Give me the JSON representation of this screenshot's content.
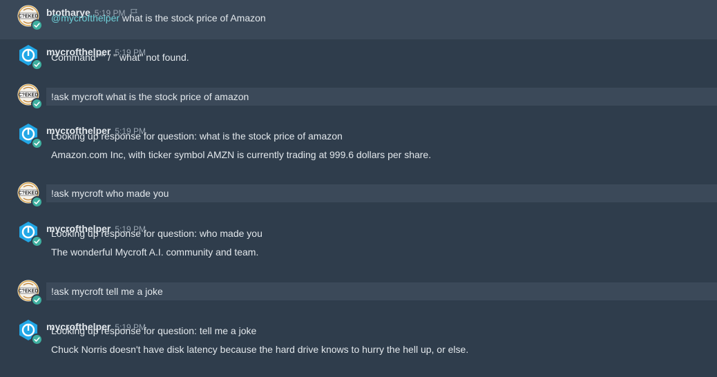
{
  "groups": [
    {
      "user": "btotharye",
      "avatar": "cheked-icon",
      "time": "5:19 PM",
      "flag": true,
      "lines": [
        {
          "mention": "@mycrofthelper",
          "text": " what is the stock price of Amazon"
        }
      ]
    },
    {
      "user": "mycrofthelper",
      "avatar": "mycroft-icon",
      "time": "5:19 PM",
      "lines": [
        {
          "text": "Command \"\" / \" what\" not found."
        }
      ]
    },
    {
      "user": "btotharye",
      "avatar": "cheked-icon",
      "time": "5:19 PM",
      "lines": [
        {
          "text": "!ask mycroft what is the stock price of amazon"
        }
      ]
    },
    {
      "user": "mycrofthelper",
      "avatar": "mycroft-icon",
      "time": "5:19 PM",
      "lines": [
        {
          "text": "Looking up response for question: what is the stock price of amazon"
        },
        {
          "text": "Amazon.com Inc, with ticker symbol AMZN is currently trading at 999.6 dollars per share."
        }
      ]
    },
    {
      "user": "btotharye",
      "avatar": "cheked-icon",
      "time": "5:19 PM",
      "lines": [
        {
          "text": "!ask mycroft who made you"
        }
      ]
    },
    {
      "user": "mycrofthelper",
      "avatar": "mycroft-icon",
      "time": "5:19 PM",
      "lines": [
        {
          "text": "Looking up response for question: who made you"
        },
        {
          "text": "The wonderful Mycroft A.I. community and team."
        }
      ]
    },
    {
      "user": "btotharye",
      "avatar": "cheked-icon",
      "time": "5:19 PM",
      "lines": [
        {
          "text": "!ask mycroft tell me a joke"
        }
      ]
    },
    {
      "user": "mycrofthelper",
      "avatar": "mycroft-icon",
      "time": "5:19 PM",
      "lines": [
        {
          "text": "Looking up response for question: tell me a joke"
        },
        {
          "text": "Chuck Norris doesn't have disk latency because the hard drive knows to hurry the hell up, or else."
        }
      ]
    }
  ],
  "colors": {
    "background": "#2f3d4c",
    "highlight": "#3a4858",
    "mention": "#6fd0d8",
    "status_online": "#3fb0a0"
  }
}
